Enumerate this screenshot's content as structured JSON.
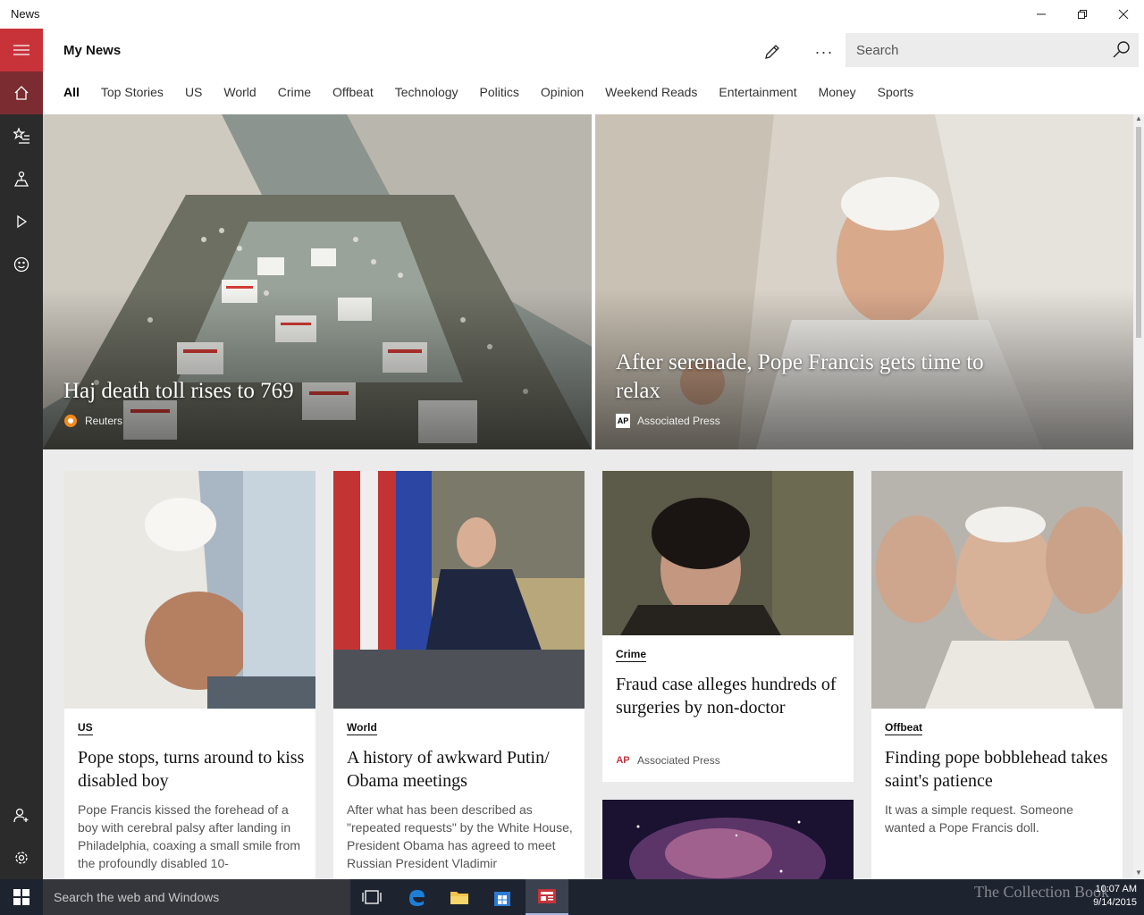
{
  "window": {
    "title": "News"
  },
  "header": {
    "page_title": "My News",
    "search_placeholder": "Search",
    "more_label": "···"
  },
  "tabs": [
    {
      "label": "All",
      "active": true
    },
    {
      "label": "Top Stories"
    },
    {
      "label": "US"
    },
    {
      "label": "World"
    },
    {
      "label": "Crime"
    },
    {
      "label": "Offbeat"
    },
    {
      "label": "Technology"
    },
    {
      "label": "Politics"
    },
    {
      "label": "Opinion"
    },
    {
      "label": "Weekend Reads"
    },
    {
      "label": "Entertainment"
    },
    {
      "label": "Money"
    },
    {
      "label": "Sports"
    }
  ],
  "hero": [
    {
      "title": "Haj death toll rises to 769",
      "source": "Reuters",
      "icon": "reuters-logo"
    },
    {
      "title": "After serenade, Pope Francis gets time to relax",
      "source": "Associated Press",
      "icon": "ap-logo"
    }
  ],
  "cards": [
    {
      "category": "US",
      "title": "Pope stops, turns around to kiss disabled boy",
      "body": "Pope Francis kissed the forehead of a boy with cerebral palsy after landing in Philadelphia, coaxing a small smile from the profoundly disabled 10-"
    },
    {
      "category": "World",
      "title": "A history of awkward Putin/ Obama meetings",
      "body": "After what has been described as \"repeated requests\" by the White House, President Obama has agreed to meet Russian President Vladimir"
    },
    {
      "category": "Crime",
      "title": "Fraud case alleges hundreds of surgeries by non-doctor",
      "source": "Associated Press"
    },
    {
      "category": "Offbeat",
      "title": "Finding pope bobblehead takes saint's patience",
      "body": "It was a simple request. Someone wanted a Pope Francis doll."
    }
  ],
  "taskbar": {
    "search_text": "Search the web and Windows",
    "time": "10:07 AM",
    "date": "9/14/2015",
    "watermark": "The Collection Book"
  },
  "colors": {
    "accent_red": "#c8333a",
    "rail_bg": "#2b2b2b",
    "taskbar_bg": "#1e2330"
  }
}
